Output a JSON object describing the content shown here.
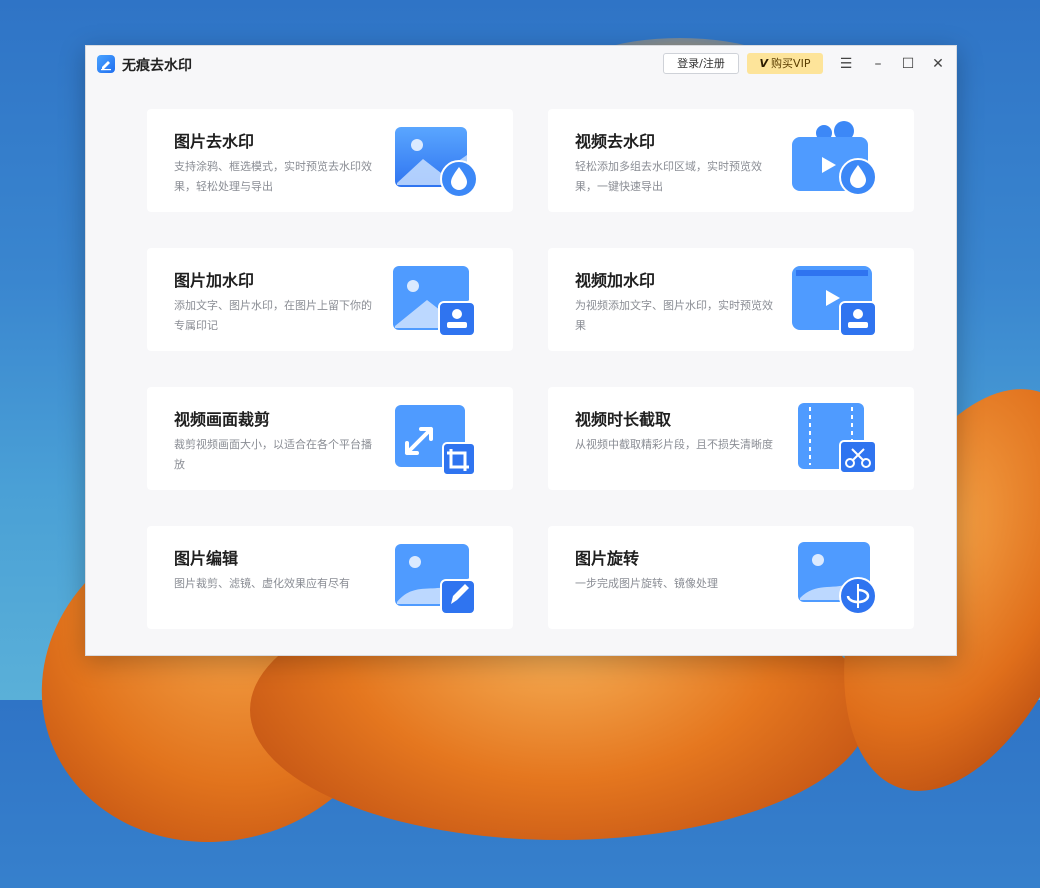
{
  "window": {
    "title": "无痕去水印",
    "login_label": "登录/注册",
    "vip_label": "购买VIP",
    "vip_icon": "V"
  },
  "cards": [
    {
      "title": "图片去水印",
      "desc": "支持涂鸦、框选模式，实时预览去水印效果，轻松处理与导出",
      "icon": "image-droplet-icon"
    },
    {
      "title": "视频去水印",
      "desc": "轻松添加多组去水印区域，实时预览效果，一键快速导出",
      "icon": "video-droplet-icon"
    },
    {
      "title": "图片加水印",
      "desc": "添加文字、图片水印，在图片上留下你的专属印记",
      "icon": "image-stamp-icon"
    },
    {
      "title": "视频加水印",
      "desc": "为视频添加文字、图片水印，实时预览效果",
      "icon": "video-stamp-icon"
    },
    {
      "title": "视频画面裁剪",
      "desc": "裁剪视频画面大小，以适合在各个平台播放",
      "icon": "video-crop-icon"
    },
    {
      "title": "视频时长截取",
      "desc": "从视频中截取精彩片段，且不损失清晰度",
      "icon": "video-trim-icon"
    },
    {
      "title": "图片编辑",
      "desc": "图片裁剪、滤镜、虚化效果应有尽有",
      "icon": "image-edit-icon"
    },
    {
      "title": "图片旋转",
      "desc": "一步完成图片旋转、镜像处理",
      "icon": "image-rotate-icon"
    }
  ],
  "colors": {
    "accent": "#2f7ef5",
    "vip_bg": "#fde49a"
  }
}
